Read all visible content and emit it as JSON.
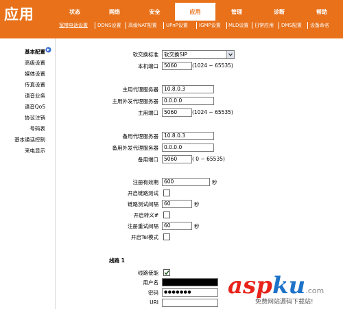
{
  "app": {
    "title": "应用"
  },
  "topnav": {
    "tabs": [
      {
        "label": "状态"
      },
      {
        "label": "网络"
      },
      {
        "label": "安全"
      },
      {
        "label": "应用"
      },
      {
        "label": "管理"
      },
      {
        "label": "诊断"
      },
      {
        "label": "帮助"
      }
    ],
    "active": "应用"
  },
  "subnav": {
    "items": [
      "宽带电话设置",
      "DDNS设置",
      "高级NAT配置",
      "UPnP设置",
      "IGMP设置",
      "MLD设置",
      "日常应用",
      "DMS配置",
      "设备命名"
    ]
  },
  "sidebar": {
    "items": [
      "基本配置",
      "高级设置",
      "媒体设置",
      "传真设置",
      "语音业务",
      "语音QoS",
      "协议注销",
      "号码表",
      "基本通话控制",
      "来电显示"
    ]
  },
  "form": {
    "softswitch": {
      "label": "软交换标准",
      "value": "软交换SIP"
    },
    "local_port": {
      "label": "本机端口",
      "value": "5060",
      "hint": "(1024 ~ 65535)"
    },
    "primary_proxy": {
      "label": "主用代理服务器",
      "value": "10.8.0.3"
    },
    "primary_outbound": {
      "label": "主用外发代理服务器",
      "value": "0.0.0.0"
    },
    "primary_port": {
      "label": "主用端口",
      "value": "5060",
      "hint": "(1024 ~ 65535)"
    },
    "backup_proxy": {
      "label": "备用代理服务器",
      "value": "10.8.0.3"
    },
    "backup_outbound": {
      "label": "备用外发代理服务器",
      "value": "0.0.0.0"
    },
    "backup_port": {
      "label": "备用端口",
      "value": "5060",
      "hint": "( 0 ~ 65535)"
    },
    "reg_expiry": {
      "label": "注册有效期",
      "value": "600",
      "unit": "秒"
    },
    "link_test": {
      "label": "开启链路测试"
    },
    "link_test_interval": {
      "label": "链路测试间隔",
      "value": "60",
      "unit": "秒"
    },
    "escape": {
      "label": "开启转义#"
    },
    "reg_retry": {
      "label": "注册重试间隔",
      "value": "60",
      "unit": "秒"
    },
    "tel_mode": {
      "label": "开启Tel模式"
    },
    "line_section": "线路 1",
    "line_enable": {
      "label": "线路使能"
    },
    "username": {
      "label": "用户名"
    },
    "password": {
      "label": "密码",
      "value": "●●●●●●●"
    },
    "uri": {
      "label": "URI",
      "value": ""
    }
  },
  "watermark": {
    "brand_a": "asp",
    "brand_b": "ku",
    "brand_c": ".com",
    "tagline": "免费网站源码下载站!"
  },
  "colors": {
    "accent": "#e8711a",
    "check": "#1a5c1a"
  }
}
